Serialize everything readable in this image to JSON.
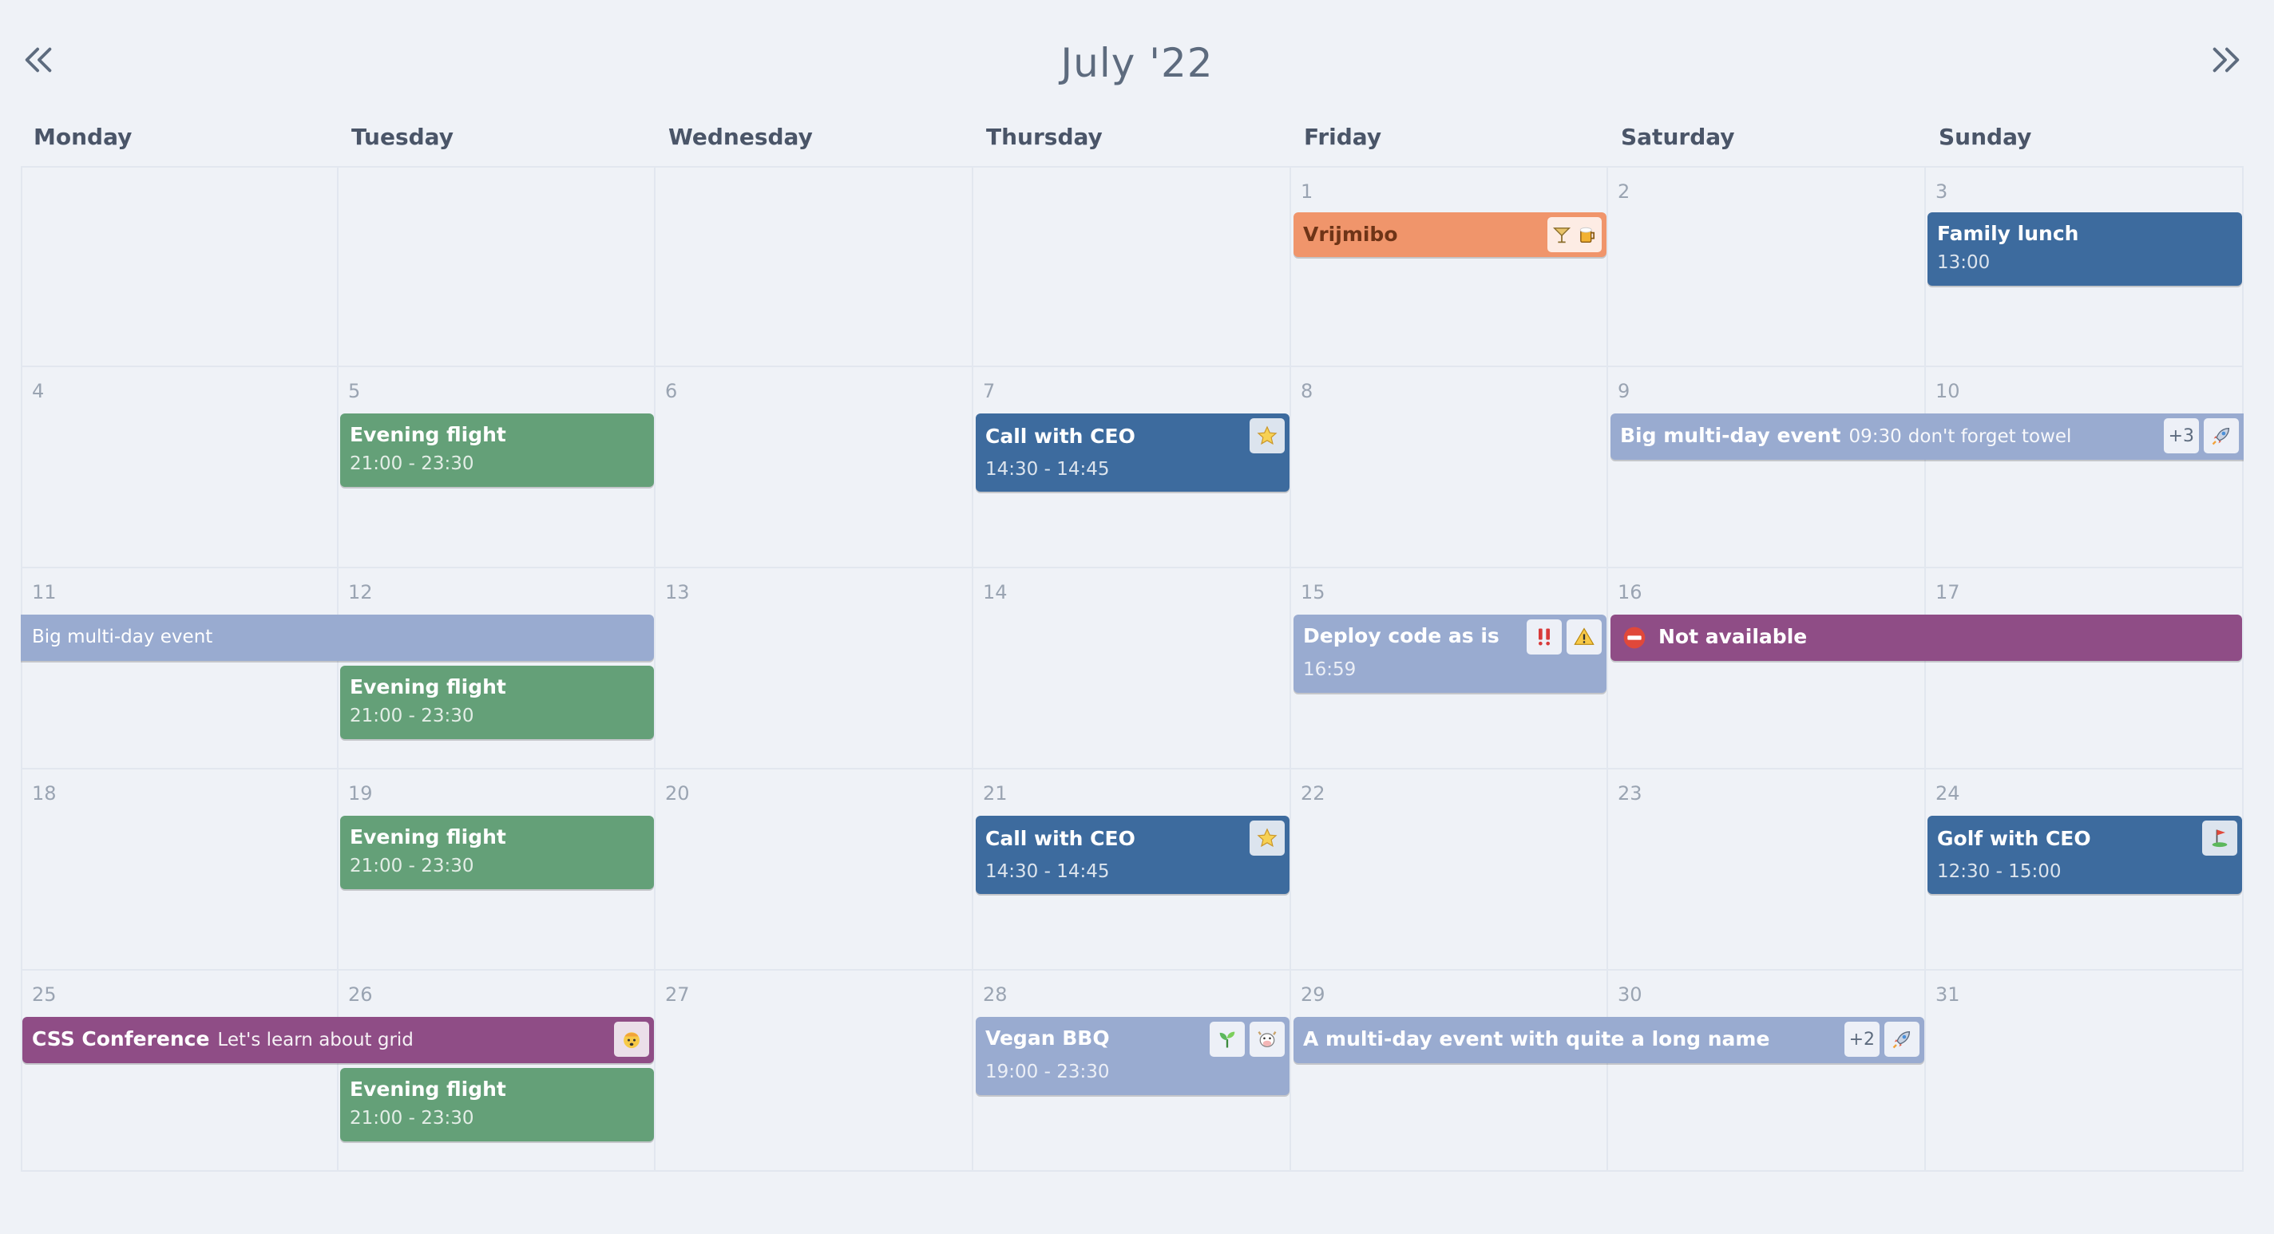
{
  "header": {
    "title": "July '22",
    "prev_icon": "double-chevron-left-icon",
    "next_icon": "double-chevron-right-icon"
  },
  "weekdays": [
    "Monday",
    "Tuesday",
    "Wednesday",
    "Thursday",
    "Friday",
    "Saturday",
    "Sunday"
  ],
  "days": {
    "d1": "1",
    "d2": "2",
    "d3": "3",
    "d4": "4",
    "d5": "5",
    "d6": "6",
    "d7": "7",
    "d8": "8",
    "d9": "9",
    "d10": "10",
    "d11": "11",
    "d12": "12",
    "d13": "13",
    "d14": "14",
    "d15": "15",
    "d16": "16",
    "d17": "17",
    "d18": "18",
    "d19": "19",
    "d20": "20",
    "d21": "21",
    "d22": "22",
    "d23": "23",
    "d24": "24",
    "d25": "25",
    "d26": "26",
    "d27": "27",
    "d28": "28",
    "d29": "29",
    "d30": "30",
    "d31": "31"
  },
  "events": {
    "vrijmibo": {
      "title": "Vrijmibo",
      "icons": [
        "cocktail-icon",
        "beer-icon"
      ],
      "color": "#f0956b"
    },
    "family_lunch": {
      "title": "Family lunch",
      "time": "13:00",
      "color": "#3d6b9e"
    },
    "evening_flight": {
      "title": "Evening flight",
      "time": "21:00 - 23:30",
      "color": "#64a078"
    },
    "call_ceo": {
      "title": "Call with CEO",
      "time": "14:30 - 14:45",
      "icon": "star-icon",
      "color": "#3d6b9e"
    },
    "big_multiday": {
      "title": "Big multi-day event",
      "time": "09:30",
      "note": "don't forget towel",
      "more": "+3",
      "icon": "rocket-icon",
      "color": "#99abd0"
    },
    "big_multiday_cont": {
      "title": "Big multi-day event"
    },
    "deploy": {
      "title": "Deploy code as is",
      "time": "16:59",
      "icons": [
        "double-exclamation-icon",
        "warning-icon"
      ],
      "color": "#99abd0"
    },
    "not_available": {
      "title": "Not available",
      "icon": "no-entry-icon",
      "color": "#8f4d86"
    },
    "golf": {
      "title": "Golf with CEO",
      "time": "12:30 - 15:00",
      "icon": "golf-flag-icon",
      "color": "#3d6b9e"
    },
    "css_conf": {
      "title": "CSS Conference",
      "note": "Let's learn about grid",
      "icon": "mind-blown-icon",
      "color": "#8f4d86"
    },
    "vegan_bbq": {
      "title": "Vegan BBQ",
      "time": "19:00 - 23:30",
      "icons": [
        "seedling-icon",
        "cow-icon"
      ],
      "color": "#99abd0"
    },
    "long_multiday": {
      "title": "A multi-day event with quite a long name",
      "more": "+2",
      "icon": "rocket-icon",
      "color": "#99abd0"
    }
  }
}
